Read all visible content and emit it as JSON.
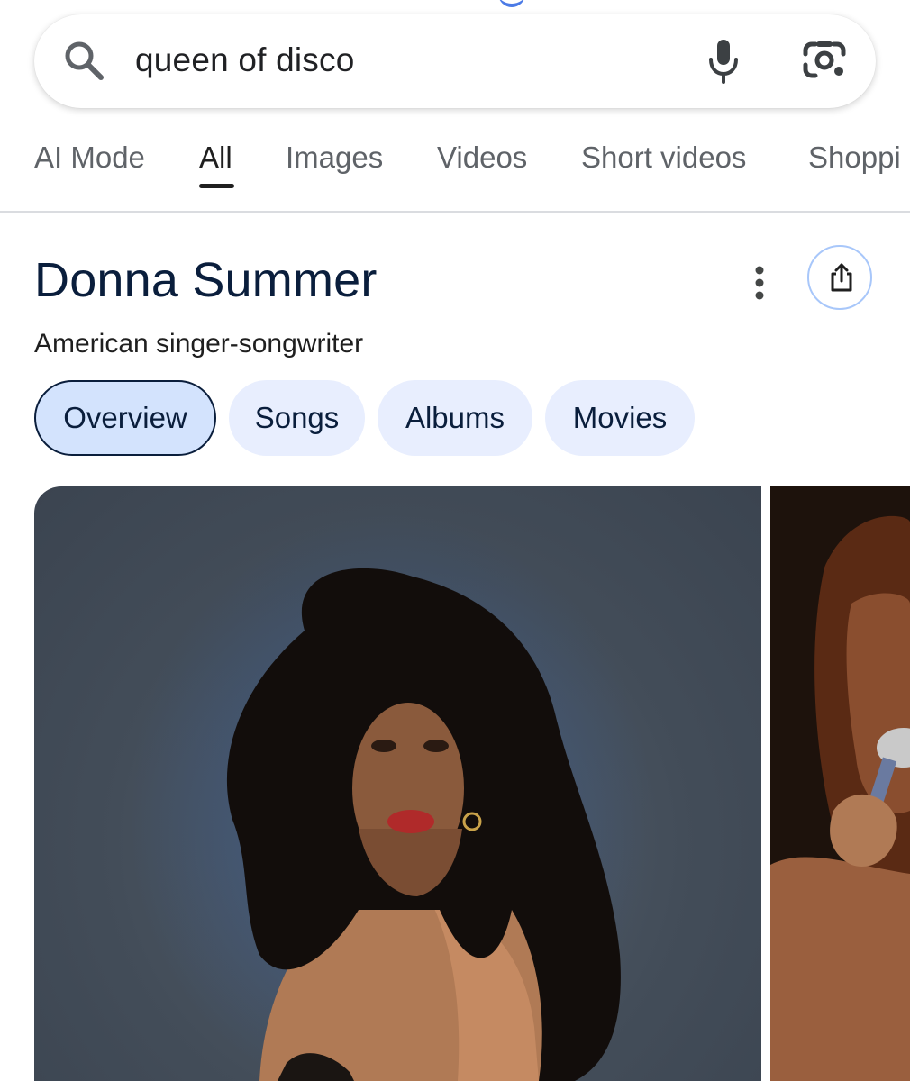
{
  "search": {
    "query": "queen of disco",
    "icons": [
      "search-icon",
      "microphone-icon",
      "google-lens-icon"
    ]
  },
  "tabs": [
    {
      "label": "AI Mode",
      "active": false
    },
    {
      "label": "All",
      "active": true
    },
    {
      "label": "Images",
      "active": false
    },
    {
      "label": "Videos",
      "active": false
    },
    {
      "label": "Short videos",
      "active": false
    },
    {
      "label": "Shoppi",
      "active": false
    }
  ],
  "entity": {
    "title": "Donna Summer",
    "subtitle": "American singer-songwriter",
    "actions": [
      "more-options-icon",
      "share-icon"
    ]
  },
  "chips": [
    {
      "label": "Overview",
      "selected": true
    },
    {
      "label": "Songs",
      "selected": false
    },
    {
      "label": "Albums",
      "selected": false
    },
    {
      "label": "Movies",
      "selected": false
    }
  ],
  "images": [
    "portrait-photo",
    "performance-photo"
  ],
  "colors": {
    "accent": "#0b57d0",
    "chip_bg": "#e8eefe",
    "chip_selected_bg": "#d3e3fd",
    "title": "#0a1e3c",
    "tab_inactive": "#5f6368",
    "divider": "#dadce0"
  }
}
